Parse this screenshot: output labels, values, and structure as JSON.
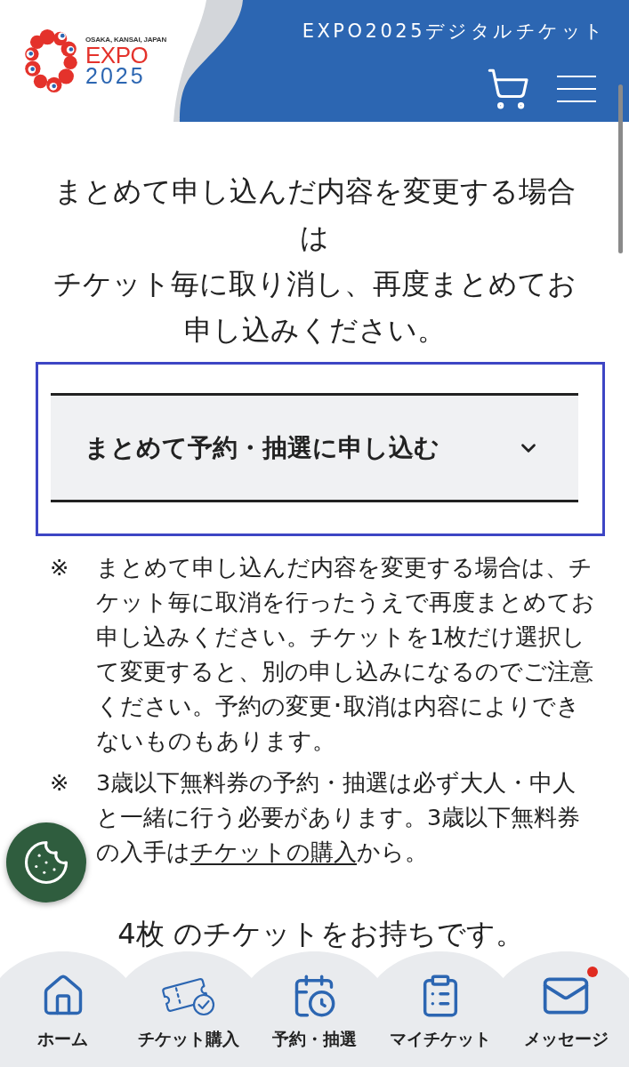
{
  "header": {
    "logo": {
      "tagline": "OSAKA, KANSAI, JAPAN",
      "wordmark": "EXPO",
      "year": "2025"
    },
    "title": "EXPO2025デジタルチケット"
  },
  "intro": {
    "lines": [
      "まとめて申し込んだ内容を変更する場合は",
      "チケット毎に取り消し、再度まとめてお申し込みください。"
    ]
  },
  "accordion": {
    "title": "まとめて予約・抽選に申し込む",
    "expanded": false,
    "focused": true
  },
  "notes": [
    {
      "mark": "※",
      "lines": [
        [
          {
            "kind": "text",
            "text": "まとめて申し込んだ内容を変更する場合は、チ"
          }
        ],
        [
          {
            "kind": "text",
            "text": "ケット毎に取消を行ったうえで再度まとめてお"
          }
        ],
        [
          {
            "kind": "text",
            "text": "申し込みください。チケットを1枚だけ選択し"
          }
        ],
        [
          {
            "kind": "text",
            "text": "て変更すると、別の申し込みになるのでご注意"
          }
        ],
        [
          {
            "kind": "text",
            "text": "ください。予約の変更･取消は内容によりでき"
          }
        ],
        [
          {
            "kind": "text",
            "text": "ないものもあります。"
          }
        ]
      ]
    },
    {
      "mark": "※",
      "lines": [
        [
          {
            "kind": "text",
            "text": "3歳以下無料券の予約・抽選は必ず大人・中人"
          }
        ],
        [
          {
            "kind": "text",
            "text": "と一緒に行う必要があります。3歳以下無料券"
          }
        ],
        [
          {
            "kind": "text",
            "text": "の入手は"
          },
          {
            "kind": "link",
            "text": "チケットの購入"
          },
          {
            "kind": "text",
            "text": "から。"
          }
        ]
      ]
    }
  ],
  "ticket_count": "4枚 のチケットをお持ちです。",
  "nav": {
    "items": [
      {
        "label": "ホーム",
        "notification": false
      },
      {
        "label": "チケット購入",
        "notification": false
      },
      {
        "label": "予約・抽選",
        "notification": false
      },
      {
        "label": "マイチケット",
        "notification": false
      },
      {
        "label": "メッセージ",
        "notification": true
      }
    ]
  }
}
